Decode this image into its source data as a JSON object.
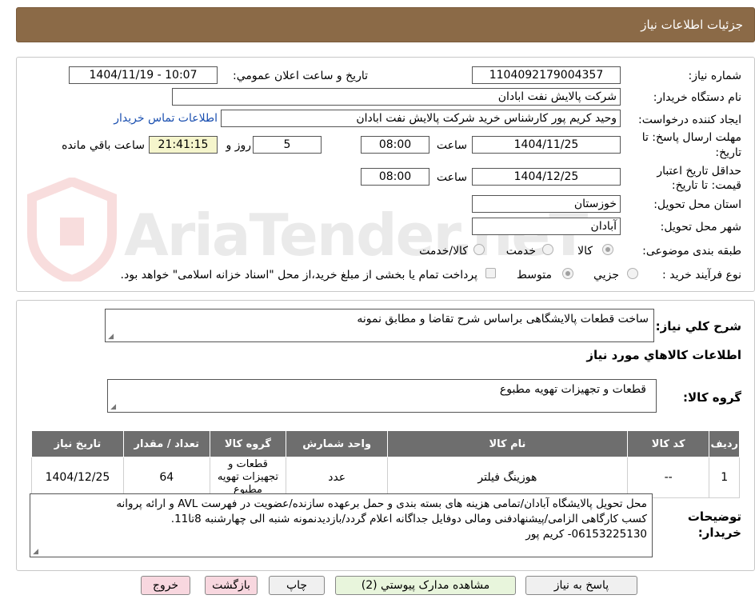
{
  "header": {
    "title": "جزئيات اطلاعات نياز"
  },
  "fields": {
    "need_no_label": "شماره نياز:",
    "need_no": "1104092179004357",
    "announce_label": "تاريخ و ساعت اعلان عمومي:",
    "announce_value": "1404/11/19 - 10:07",
    "buyer_org_label": "نام دستگاه خريدار:",
    "buyer_org": "شرکت پالايش نفت ابادان",
    "requester_label": "ايجاد کننده درخواست:",
    "requester": "وحيد کريم پور کارشناس خريد  شرکت پالايش نفت ابادان",
    "contact_link": "اطلاعات تماس خريدار",
    "deadline_label_1": "مهلت ارسال پاسخ: تا",
    "deadline_label_2": "تاريخ:",
    "deadline_date": "1404/11/25",
    "time_label": "ساعت",
    "deadline_time": "08:00",
    "days_value": "5",
    "days_label": "روز و",
    "remaining_time": "21:41:15",
    "remaining_label": "ساعت باقي مانده",
    "validity_label_1": "حداقل تاريخ اعتبار",
    "validity_label_2": "قيمت: تا تاريخ:",
    "validity_date": "1404/12/25",
    "validity_time": "08:00",
    "province_label": "استان محل تحويل:",
    "province": "خوزستان",
    "city_label": "شهر محل تحويل:",
    "city": "آبادان",
    "category_label": "طبقه بندی موضوعی:",
    "category_options": [
      "کالا",
      "خدمت",
      "کالا/خدمت"
    ],
    "category_selected": "کالا",
    "process_label": "نوع فرآيند خريد :",
    "process_options": [
      "جزيي",
      "متوسط"
    ],
    "process_selected": "متوسط",
    "payment_note": "پرداخت تمام يا بخشی از مبلغ خريد،از محل \"اسناد خزانه اسلامی\" خواهد بود."
  },
  "description": {
    "label": "شرح کلي نياز:",
    "value": "ساخت قطعات پالایشگاهی براساس شرح تقاضا و مطابق نمونه"
  },
  "goods_section": {
    "title": "اطلاعات کالاهاي مورد نياز",
    "group_label": "گروه کالا:",
    "group_value": "قطعات و تجهیزات تهویه مطبوع"
  },
  "table": {
    "headers": [
      "رديف",
      "کد کالا",
      "نام کالا",
      "واحد شمارش",
      "گروه کالا",
      "تعداد / مقدار",
      "تاريخ نياز"
    ],
    "rows": [
      [
        "1",
        "--",
        "هوزینگ فیلتر",
        "عدد",
        "قطعات و تجهیزات تهویه مطبوع",
        "64",
        "1404/12/25"
      ]
    ]
  },
  "buyer_notes": {
    "label_1": "توضيحات",
    "label_2": "خريدار:",
    "line_1": "محل تحویل پالایشگاه آبادان/تمامی هزینه های بسته بندی و حمل برعهده سازنده/عضویت در فهرست AVL و ارائه پروانه",
    "line_2": "کسب کارگاهی الزامی/پیشنهادفنی ومالی دوفایل جداگانه اعلام گردد/بازدیدنمونه شنبه الی چهارشنبه 8تا11.",
    "line_3": "06153225130- کریم پور"
  },
  "buttons": {
    "reply": "پاسخ به نياز",
    "attachments": "مشاهده مدارک پيوستي (2)",
    "print": "چاپ",
    "back": "بازگشت",
    "exit": "خروج"
  },
  "watermark": {
    "text": "AriaTender.neT"
  },
  "colors": {
    "header": "#8b6a47",
    "table_header": "#6e6e6e",
    "time_box": "#f5f5cc",
    "link": "#1a4fb0"
  }
}
